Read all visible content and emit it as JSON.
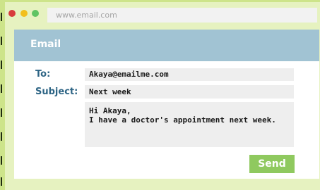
{
  "browser": {
    "url": "www.email.com"
  },
  "email": {
    "header_title": "Email",
    "to_label": "To:",
    "to_value": "Akaya@emailme.com",
    "subject_label": "Subject:",
    "subject_value": "Next week",
    "body_lines": [
      "Hi Akaya,",
      "I have a doctor's appointment next week."
    ],
    "send_label": "Send"
  },
  "colors": {
    "background": "#cde48a",
    "browser_frame": "#e6f2c0",
    "header": "#a1c3d3",
    "label": "#2e6585",
    "send_button": "#8fc95f",
    "dot_red": "#d83c3c",
    "dot_yellow": "#f2bf1c",
    "dot_green": "#5fc463"
  }
}
